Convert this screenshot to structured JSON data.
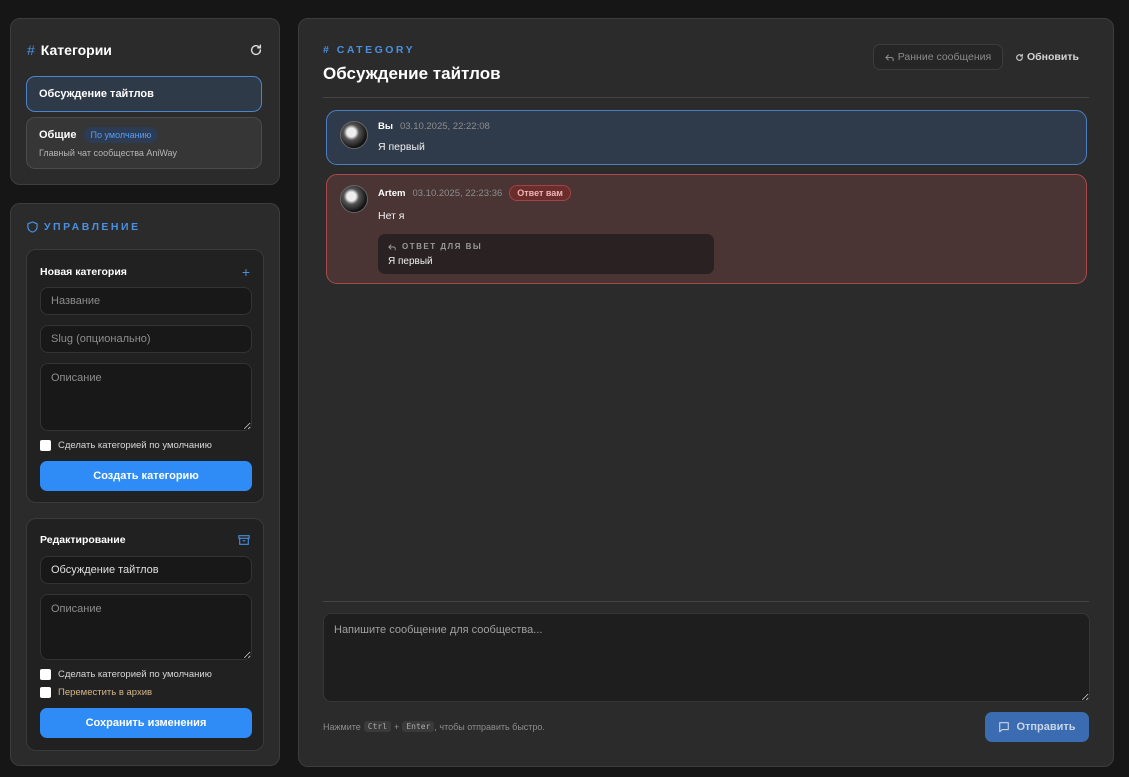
{
  "categories_panel": {
    "title": "Категории",
    "items": [
      {
        "name": "Обсуждение тайтлов"
      },
      {
        "name": "Общие",
        "badge": "По умолчанию",
        "description": "Главный чат сообщества AniWay"
      }
    ]
  },
  "manage_panel": {
    "title": "УПРАВЛЕНИЕ",
    "new_category": {
      "title": "Новая категория",
      "name_placeholder": "Название",
      "slug_placeholder": "Slug (опционально)",
      "description_placeholder": "Описание",
      "default_checkbox_label": "Сделать категорией по умолчанию",
      "create_button": "Создать категорию"
    },
    "edit": {
      "title": "Редактирование",
      "name_value": "Обсуждение тайтлов",
      "description_placeholder": "Описание",
      "default_checkbox_label": "Сделать категорией по умолчанию",
      "archive_checkbox_label": "Переместить в архив",
      "save_button": "Сохранить изменения"
    }
  },
  "chat": {
    "eyebrow": "CATEGORY",
    "title": "Обсуждение тайтлов",
    "early_messages_button": "Ранние сообщения",
    "refresh_button": "Обновить",
    "messages": [
      {
        "author": "Вы",
        "time": "03.10.2025, 22:22:08",
        "text": "Я первый"
      },
      {
        "author": "Artem",
        "time": "03.10.2025, 22:23:36",
        "badge": "Ответ вам",
        "text": "Нет я",
        "reply": {
          "label": "ОТВЕТ ДЛЯ ВЫ",
          "text": "Я первый"
        }
      }
    ],
    "composer_placeholder": "Напишите сообщение для сообщества...",
    "hint_prefix": "Нажмите",
    "hint_key1": "Ctrl",
    "hint_plus": "+",
    "hint_key2": "Enter",
    "hint_suffix": ", чтобы отправить быстро.",
    "send_button": "Отправить"
  },
  "colors": {
    "accent": "#2f8bf5",
    "own_message_bg": "#2f3b4a",
    "reply_message_bg": "#4a3434",
    "archive_label": "#d6b88a"
  },
  "icons": [
    "hash-icon",
    "refresh-icon",
    "shield-icon",
    "plus-icon",
    "archive-icon",
    "reply-icon",
    "chat-bubble-icon"
  ]
}
